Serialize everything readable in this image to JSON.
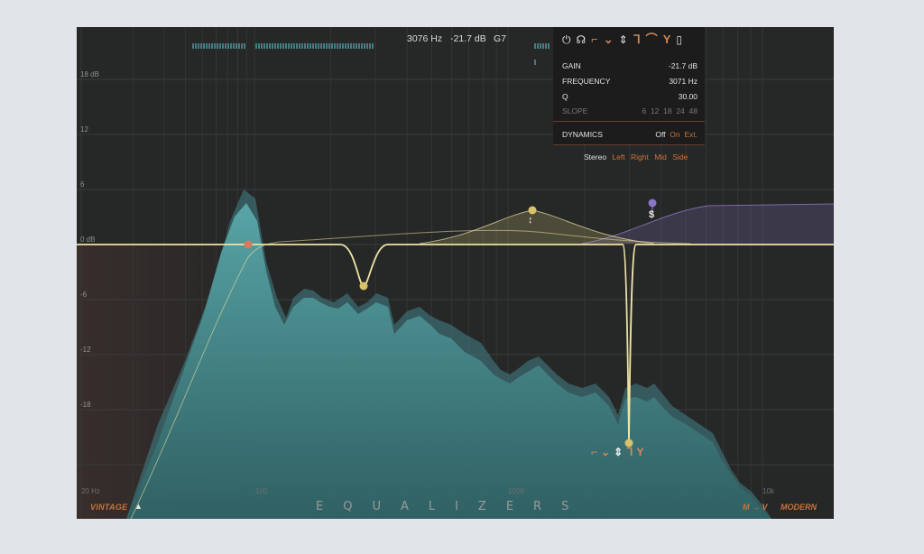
{
  "readout": {
    "frequency": "3076 Hz",
    "gain": "-21.7 dB",
    "note": "G7"
  },
  "panel": {
    "icons": [
      "power-icon",
      "headphones-icon",
      "low-shelf-icon",
      "bell-icon",
      "notch-icon",
      "high-shelf-icon",
      "high-cut-icon",
      "trash-icon"
    ],
    "gain": {
      "label": "GAIN",
      "value": "-21.7 dB"
    },
    "frequency": {
      "label": "FREQUENCY",
      "value": "3071 Hz"
    },
    "q": {
      "label": "Q",
      "value": "30.00"
    },
    "slope": {
      "label": "SLOPE",
      "options": [
        "6",
        "12",
        "18",
        "24",
        "48"
      ]
    },
    "dynamics": {
      "label": "DYNAMICS",
      "off": "Off",
      "on": "On",
      "ext": "Ext."
    },
    "stereo": {
      "label": "Stereo",
      "options": [
        "Left",
        "Right",
        "Mid",
        "Side"
      ]
    }
  },
  "y_axis": [
    "18 dB",
    "12",
    "6",
    "0 dB",
    "-6",
    "-12",
    "-18"
  ],
  "x_axis": [
    "20 Hz",
    "100",
    "1000",
    "10k"
  ],
  "bottom": {
    "vintage": "VINTAGE",
    "arrow": "▲",
    "title": "EQUALIZERS",
    "mv": "M → V",
    "modern": "MODERN"
  },
  "colors": {
    "accent": "#c9743f",
    "curve": "#efe3a4",
    "spectrum": "#4f9ea2",
    "dynamic_band": "#8a76c4"
  }
}
